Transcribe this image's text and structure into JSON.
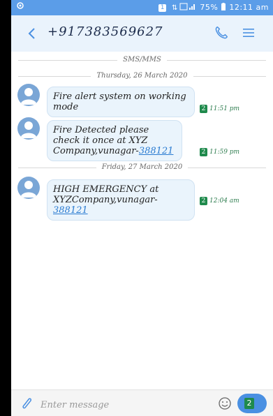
{
  "status_bar": {
    "left_icon": "location-icon",
    "sim_label": "1",
    "battery": "75%",
    "time": "12:11 am"
  },
  "header": {
    "contact": "+917383569627",
    "back_icon": "back-arrow-icon",
    "call_icon": "phone-icon",
    "menu_icon": "menu-icon"
  },
  "thread": {
    "channel_label": "SMS/MMS",
    "day1": "Thursday, 26 March 2020",
    "day2": "Friday, 27 March 2020",
    "messages": [
      {
        "text": "Fire alert system on working mode",
        "sim": "2",
        "time": "11:51 pm"
      },
      {
        "text_prefix": "Fire Detected please check it once at XYZ Company,vunagar-",
        "link": "388121",
        "sim": "2",
        "time": "11:59 pm"
      },
      {
        "text_prefix": "HIGH EMERGENCY at XYZCompany,vunagar-",
        "link": "388121",
        "sim": "2",
        "time": "12:04 am"
      }
    ]
  },
  "composer": {
    "placeholder": "Enter message",
    "send_sim": "2"
  },
  "colors": {
    "status_bar": "#5b9de8",
    "header_bg": "#eaf3fc",
    "bubble_bg": "#eaf4fc",
    "link": "#2a7bd1",
    "sim_green": "#1f8a4c",
    "send_button": "#4a90e2"
  }
}
